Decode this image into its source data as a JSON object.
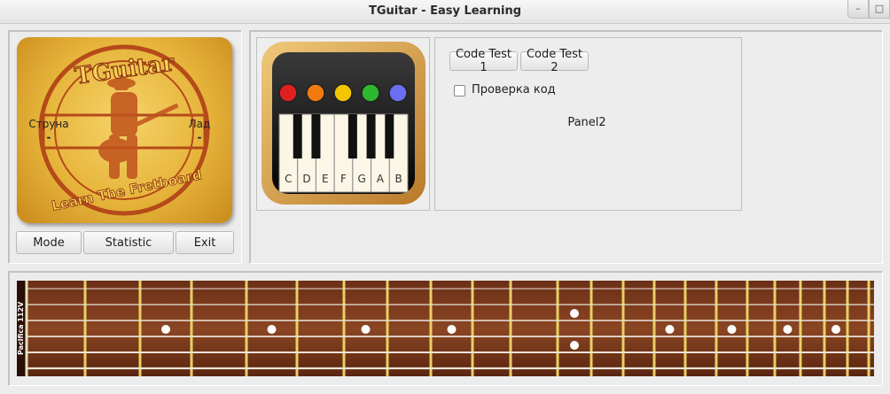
{
  "window": {
    "title": "TGuitar - Easy Learning",
    "buttons": [
      "–",
      "□"
    ]
  },
  "logo": {
    "brand": "TGuitar",
    "tagline": "Learn The Fretboard",
    "string_label": "Струна",
    "string_value": "-",
    "fret_label": "Лад",
    "fret_value": "-"
  },
  "left_buttons": {
    "mode": "Mode",
    "statistic": "Statistic",
    "exit": "Exit"
  },
  "piano": {
    "led_colors": [
      "#e02020",
      "#f07a10",
      "#f2c500",
      "#2fb82f",
      "#6a6ef0"
    ],
    "note_labels": [
      "C",
      "D",
      "E",
      "F",
      "G",
      "A",
      "B"
    ]
  },
  "panel2": {
    "code_test_1": "Code Test 1",
    "code_test_2": "Code Test 2",
    "checkbox_label": "Проверка код",
    "checkbox_checked": false,
    "panel_label": "Panel2"
  },
  "fretboard": {
    "side_label": "Pacifica 112V",
    "strings": 6,
    "markers": [
      {
        "fret": 3,
        "string": 3
      },
      {
        "fret": 5,
        "string": 3
      },
      {
        "fret": 7,
        "string": 3
      },
      {
        "fret": 9,
        "string": 3
      },
      {
        "fret": 12,
        "string": 2
      },
      {
        "fret": 12,
        "string": 4
      },
      {
        "fret": 15,
        "string": 3
      },
      {
        "fret": 17,
        "string": 3
      },
      {
        "fret": 19,
        "string": 3
      },
      {
        "fret": 21,
        "string": 3
      }
    ]
  }
}
